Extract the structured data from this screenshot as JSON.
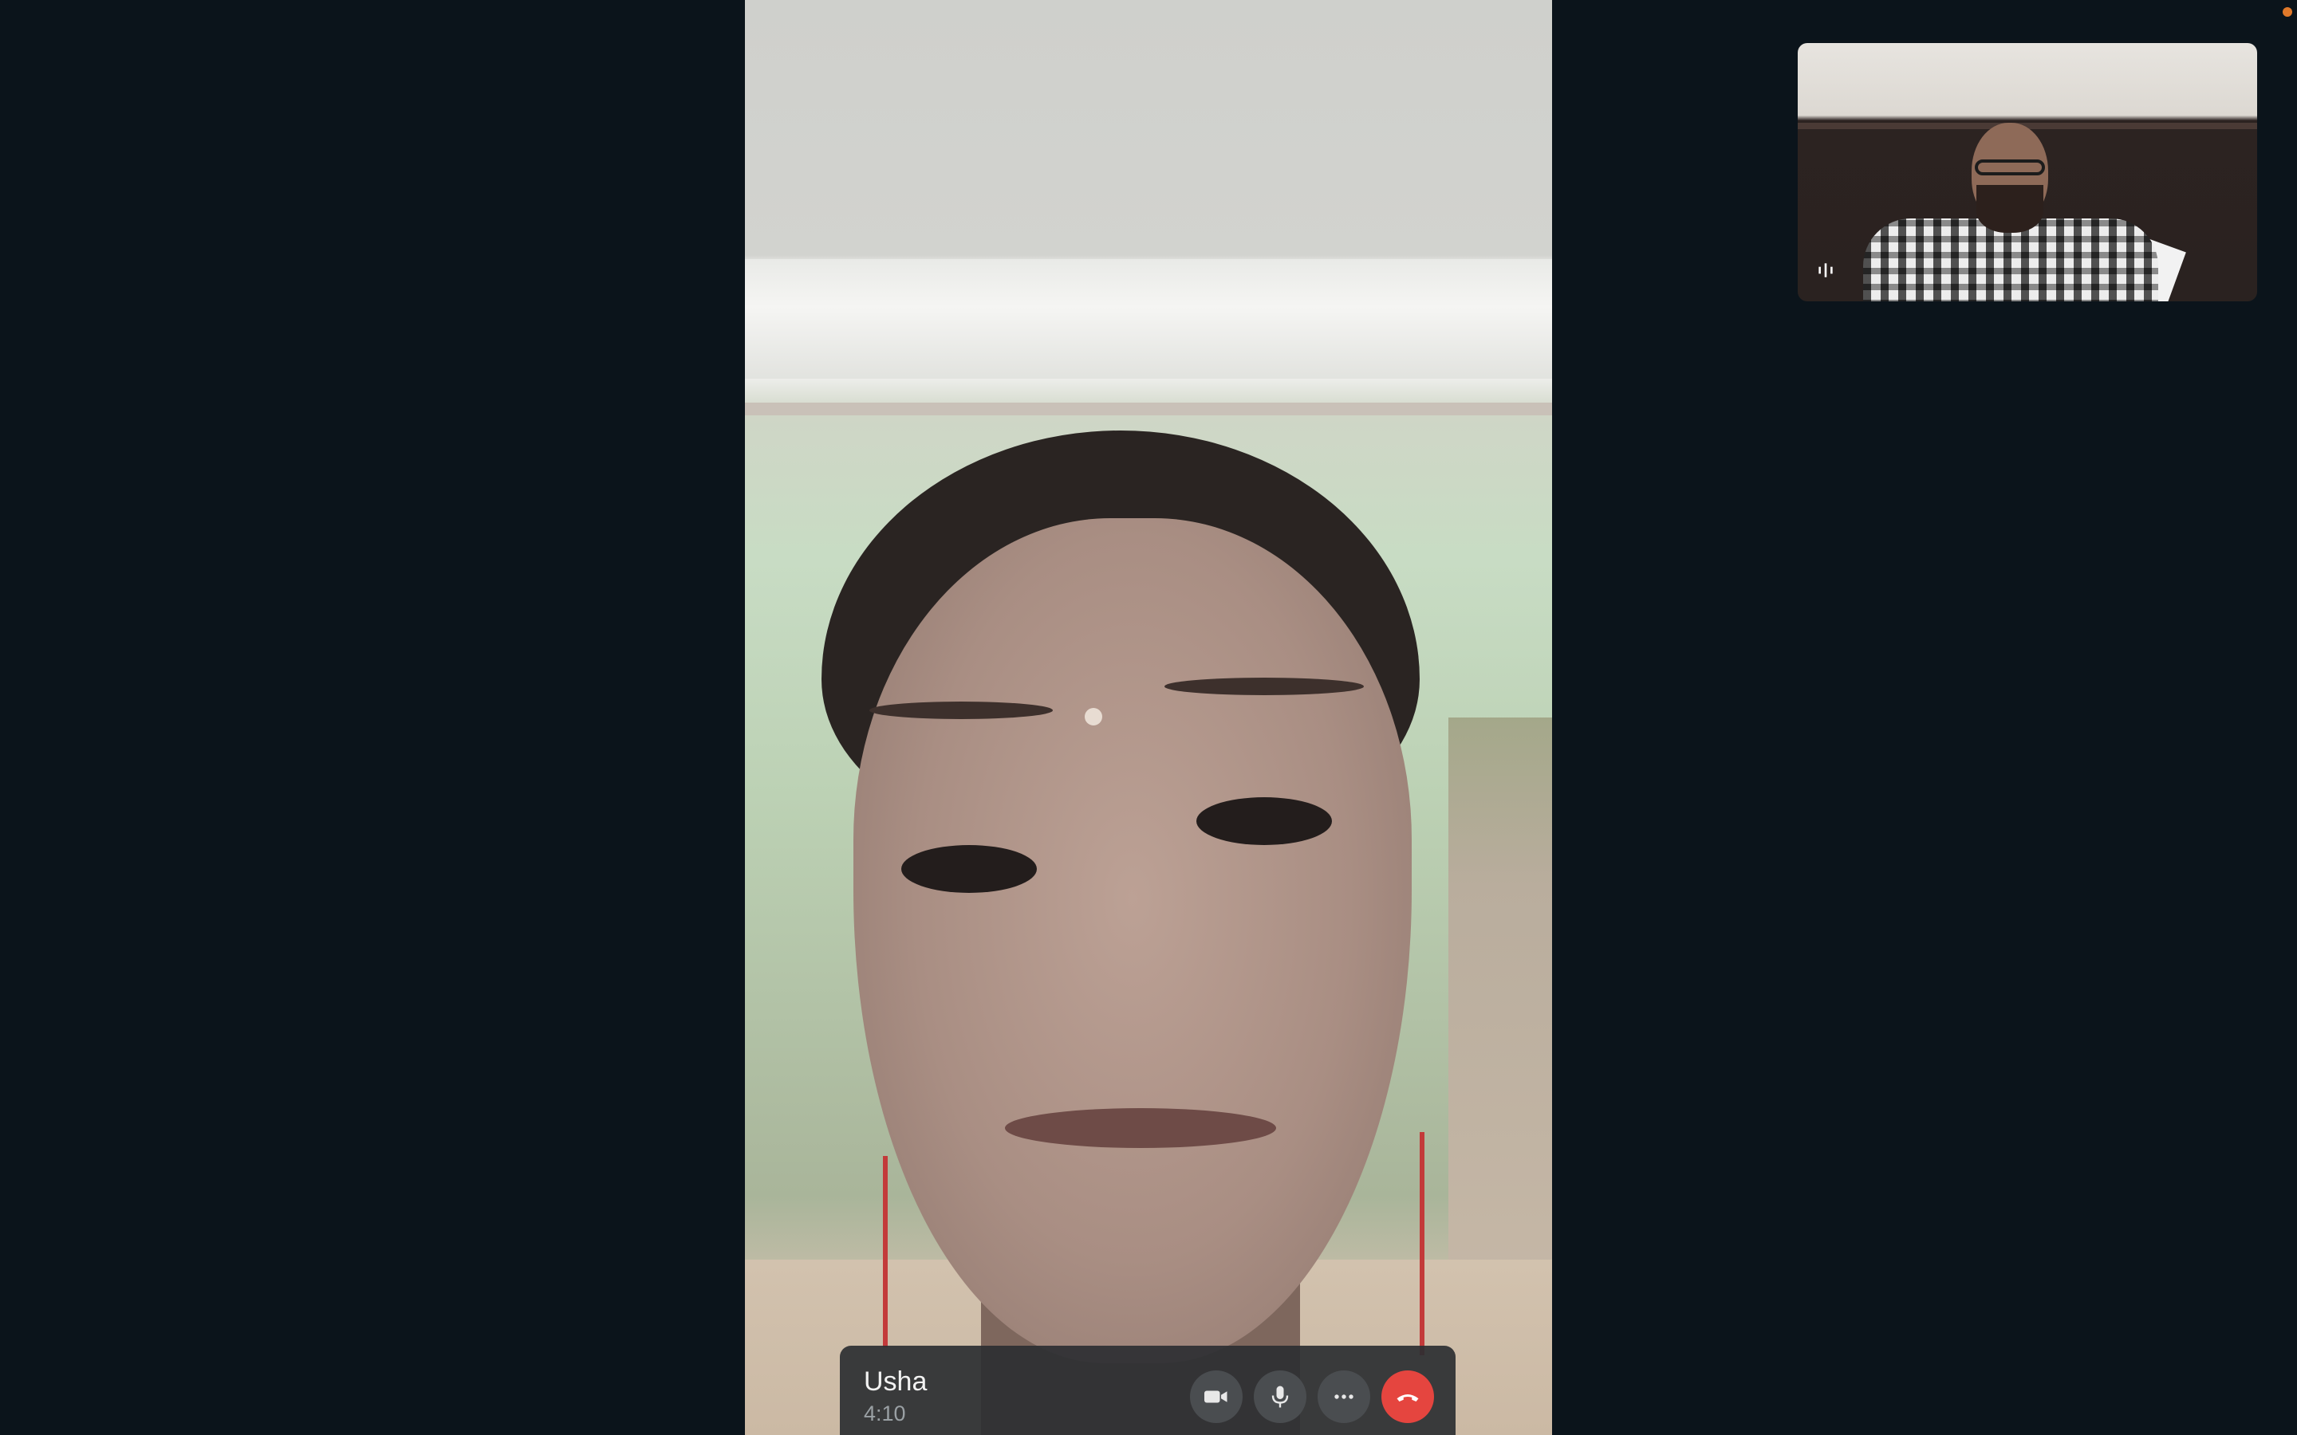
{
  "call": {
    "caller_name": "Usha",
    "duration": "4:10"
  },
  "controls": [
    {
      "name": "video-toggle",
      "icon": "video-camera-icon"
    },
    {
      "name": "mute-toggle",
      "icon": "microphone-icon"
    },
    {
      "name": "more-options",
      "icon": "more-dots-icon"
    },
    {
      "name": "end-call",
      "icon": "end-call-icon"
    }
  ],
  "colors": {
    "background": "#0b141b",
    "end_call": "#e5453f",
    "control_button": "#4a4d50",
    "recording_dot": "#e0792a"
  },
  "self_view": {
    "audio_indicator_icon": "audio-level-icon"
  }
}
